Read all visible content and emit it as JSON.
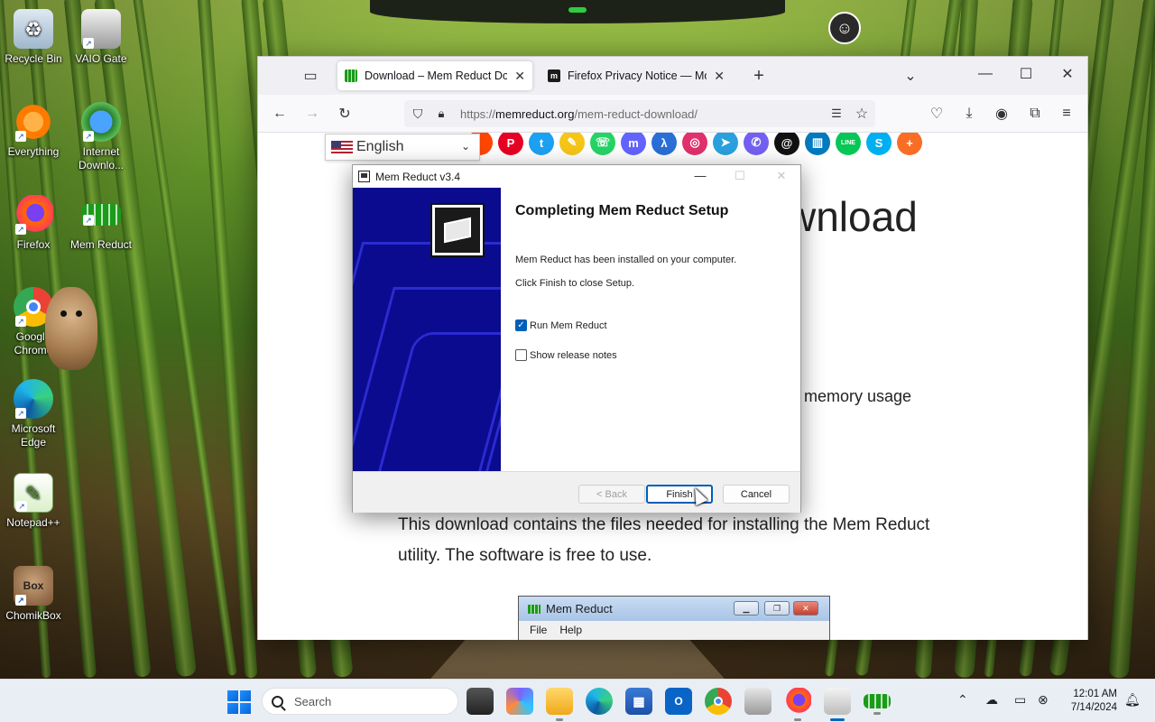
{
  "desktop": {
    "icons": [
      {
        "label": "Recycle Bin",
        "icon": "recycle-bin-icon"
      },
      {
        "label": "VAIO Gate",
        "icon": "vaio-gate-icon"
      },
      {
        "label": "Everything",
        "icon": "everything-search-icon"
      },
      {
        "label": "Internet Downlo...",
        "icon": "internet-download-manager-icon"
      },
      {
        "label": "Firefox",
        "icon": "firefox-icon"
      },
      {
        "label": "Mem Reduct",
        "icon": "mem-reduct-icon"
      },
      {
        "label": "Google Chrome",
        "icon": "chrome-icon"
      },
      {
        "label": "Microsoft Edge",
        "icon": "edge-icon"
      },
      {
        "label": "Notepad++",
        "icon": "notepad-plus-plus-icon"
      },
      {
        "label": "ChomikBox",
        "icon": "chomikbox-icon"
      }
    ]
  },
  "browser": {
    "tabs": [
      {
        "title": "Download – Mem Reduct Down",
        "favicon": "mem-reduct-favicon",
        "active": true
      },
      {
        "title": "Firefox Privacy Notice — Mozill",
        "favicon": "mozilla-favicon",
        "active": false
      }
    ],
    "url_scheme": "https://",
    "url_host": "memreduct.org",
    "url_path": "/mem-reduct-download/",
    "page": {
      "language_selector": "English",
      "heading_fragment": "wnload",
      "text_fragment": "e memory usage",
      "paragraph": "This download contains the files needed for installing the Mem Reduct utility. The software is free to use.",
      "screenshot_title": "Mem Reduct",
      "screenshot_menu": [
        "File",
        "Help"
      ],
      "social_icons": [
        {
          "name": "reddit-icon",
          "color": "#ff4500",
          "glyph": ""
        },
        {
          "name": "pinterest-icon",
          "color": "#e60023",
          "glyph": "P"
        },
        {
          "name": "twitter-icon",
          "color": "#1da1f2",
          "glyph": "t"
        },
        {
          "name": "snapchat-icon",
          "color": "#f5c518",
          "glyph": "✎"
        },
        {
          "name": "whatsapp-icon",
          "color": "#25d366",
          "glyph": "☏"
        },
        {
          "name": "mastodon-icon",
          "color": "#6364ff",
          "glyph": "m"
        },
        {
          "name": "ok-icon",
          "color": "#2a6fd6",
          "glyph": "λ"
        },
        {
          "name": "instagram-icon",
          "color": "#e1306c",
          "glyph": "◎"
        },
        {
          "name": "telegram-icon",
          "color": "#2aa1de",
          "glyph": "➤"
        },
        {
          "name": "viber-icon",
          "color": "#7360f2",
          "glyph": "✆"
        },
        {
          "name": "threads-icon",
          "color": "#111111",
          "glyph": "@"
        },
        {
          "name": "trello-icon",
          "color": "#0079bf",
          "glyph": "▥"
        },
        {
          "name": "line-icon",
          "color": "#06c755",
          "glyph": "LINE"
        },
        {
          "name": "skype-icon",
          "color": "#00aff0",
          "glyph": "S"
        },
        {
          "name": "more-share-icon",
          "color": "#f96d25",
          "glyph": "+"
        }
      ]
    }
  },
  "dialog": {
    "title": "Mem Reduct v3.4",
    "heading": "Completing Mem Reduct Setup",
    "line1": "Mem Reduct has been installed on your computer.",
    "line2": "Click Finish to close Setup.",
    "checkbox_run": {
      "label": "Run Mem Reduct",
      "checked": true
    },
    "checkbox_notes": {
      "label": "Show release notes",
      "checked": false
    },
    "back": "< Back",
    "finish": "Finish",
    "cancel": "Cancel"
  },
  "taskbar": {
    "search_placeholder": "Search",
    "time": "12:01 AM",
    "date": "7/14/2024",
    "accent": "#0067c0"
  }
}
